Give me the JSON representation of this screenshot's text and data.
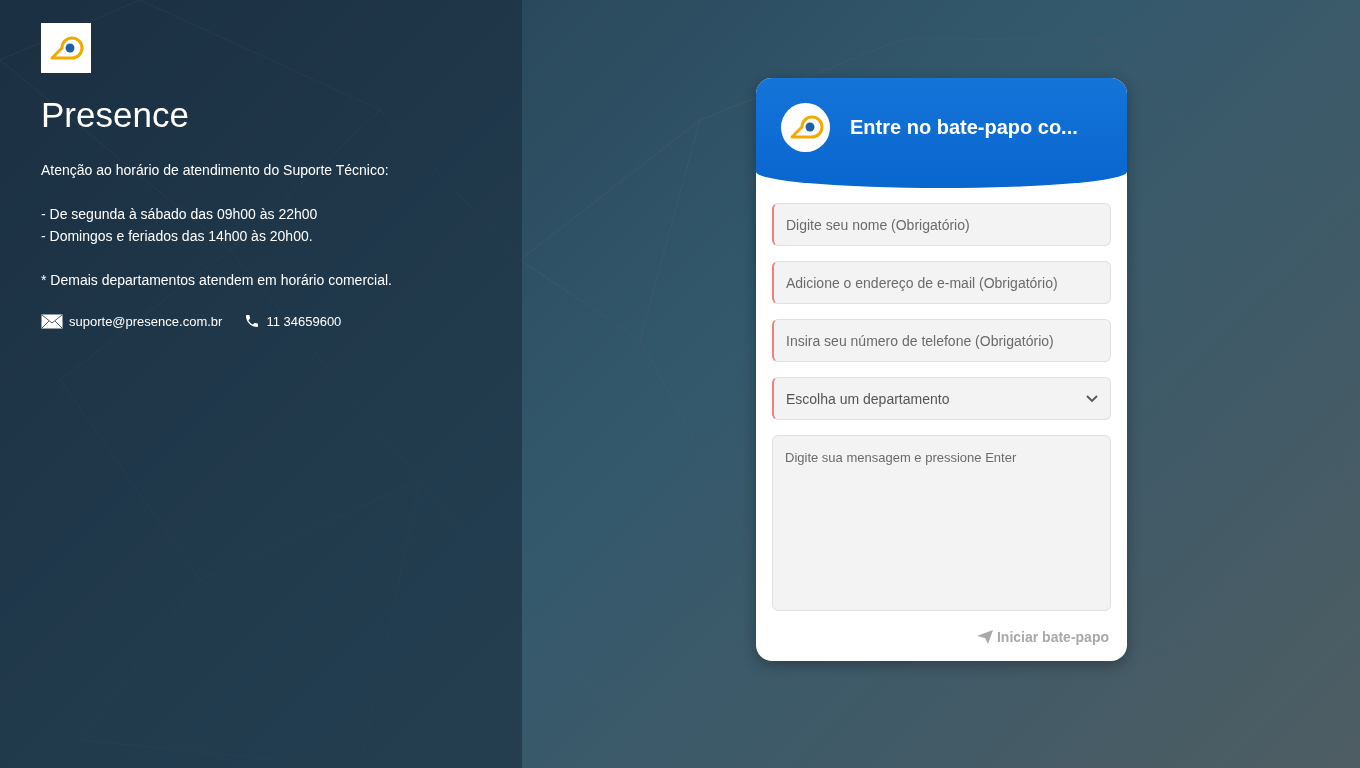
{
  "brand": {
    "title": "Presence"
  },
  "info": {
    "heading": "Atenção ao horário de atendimento do Suporte Técnico:",
    "hours": [
      "- De segunda à sábado das 09h00 às 22h00",
      "- Domingos e feriados das 14h00 às 20h00."
    ],
    "note": "* Demais departamentos atendem em horário comercial."
  },
  "contacts": [
    {
      "kind": "email",
      "text": "suporte@presence.com.br"
    },
    {
      "kind": "phone",
      "text": "11 34659600"
    }
  ],
  "chat": {
    "title": "Entre no bate-papo co...",
    "fields": [
      {
        "kind": "input",
        "placeholder": "Digite seu nome (Obrigatório)",
        "required": true
      },
      {
        "kind": "input",
        "placeholder": "Adicione o endereço de e-mail (Obrigatório)",
        "required": true
      },
      {
        "kind": "input",
        "placeholder": "Insira seu número de telefone (Obrigatório)",
        "required": true
      },
      {
        "kind": "select",
        "placeholder": "Escolha um departamento",
        "required": true
      },
      {
        "kind": "textarea",
        "placeholder": "Digite sua mensagem e pressione Enter",
        "required": false
      }
    ],
    "submit": {
      "label": "Iniciar bate-papo",
      "disabled": true
    }
  }
}
